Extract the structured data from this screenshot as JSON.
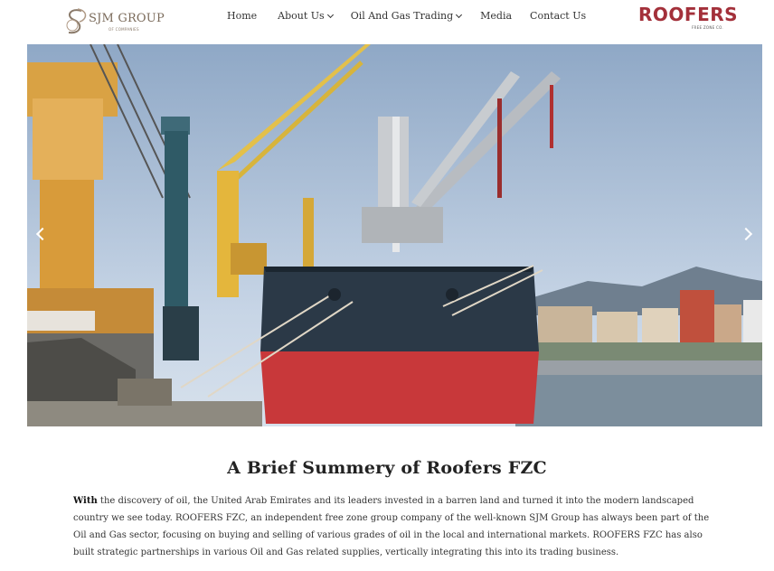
{
  "header": {
    "logo_left": {
      "brand": "SJM GROUP",
      "sub": "OF COMPANIES"
    },
    "menu": [
      {
        "label": "Home",
        "has_dropdown": false
      },
      {
        "label": "About Us",
        "has_dropdown": true
      },
      {
        "label": "Oil And Gas Trading",
        "has_dropdown": true
      },
      {
        "label": "Media",
        "has_dropdown": false
      },
      {
        "label": "Contact Us",
        "has_dropdown": false
      }
    ],
    "logo_right": {
      "brand": "ROOFERS",
      "sub": "FREE ZONE CO."
    }
  },
  "hero": {
    "prev_icon": "chevron-left-icon",
    "next_icon": "chevron-right-icon"
  },
  "content": {
    "heading": "A Brief Summery of Roofers FZC",
    "summary_lead": "With",
    "summary_rest": " the discovery of oil, the United Arab Emirates and its leaders invested in a barren land and turned it into the modern landscaped country we see today. ROOFERS FZC, an independent free zone group company of the well-known SJM Group has always been part of the Oil and Gas sector, focusing on buying and selling of various grades of oil in the local and international markets. ROOFERS FZC has also built strategic partnerships in various Oil and Gas related supplies, vertically integrating this into its trading business."
  },
  "colors": {
    "accent": "#a3303a",
    "logo_gold": "#7a6a5a",
    "ship_hull_top": "#2b3947",
    "ship_hull_bottom": "#c8383a"
  }
}
